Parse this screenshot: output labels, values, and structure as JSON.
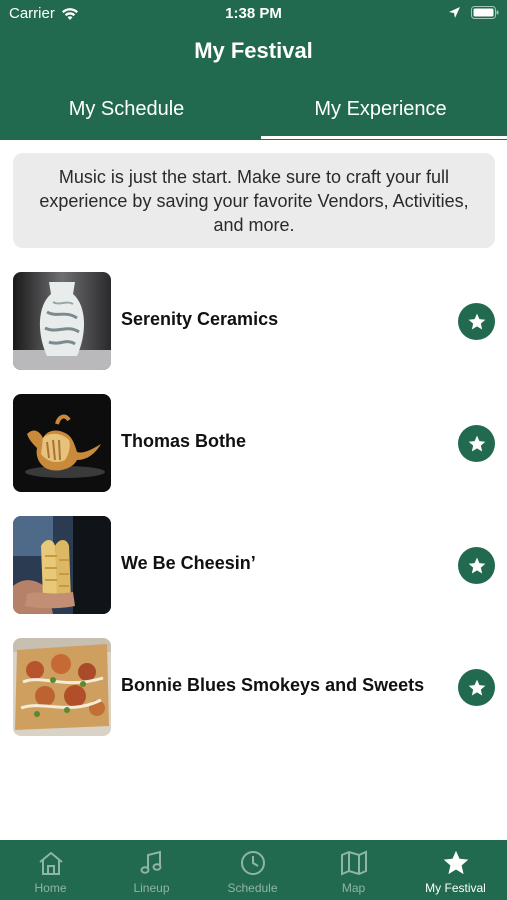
{
  "status_bar": {
    "carrier": "Carrier",
    "time": "1:38 PM",
    "icons": [
      "wifi-icon",
      "location-arrow-icon",
      "battery-icon"
    ]
  },
  "header": {
    "title": "My Festival",
    "tabs": [
      {
        "label": "My Schedule",
        "active": false
      },
      {
        "label": "My Experience",
        "active": true
      }
    ]
  },
  "notice": {
    "text": "Music is just the start. Make sure to craft your full experience by saving your favorite Vendors, Activities, and more."
  },
  "vendors": [
    {
      "name": "Serenity Ceramics",
      "image": "ceramic-vase-photo",
      "favorited": true
    },
    {
      "name": "Thomas Bothe",
      "image": "ceramic-teapot-photo",
      "favorited": true
    },
    {
      "name": "We Be Cheesin’",
      "image": "cheese-bread-photo",
      "favorited": true
    },
    {
      "name": "Bonnie Blues Smokeys and Sweets",
      "image": "loaded-fries-photo",
      "favorited": true
    }
  ],
  "tabbar": {
    "items": [
      {
        "label": "Home",
        "icon": "home-icon",
        "active": false
      },
      {
        "label": "Lineup",
        "icon": "music-note-icon",
        "active": false
      },
      {
        "label": "Schedule",
        "icon": "clock-icon",
        "active": false
      },
      {
        "label": "Map",
        "icon": "map-icon",
        "active": false
      },
      {
        "label": "My Festival",
        "icon": "star-icon",
        "active": true
      }
    ]
  },
  "colors": {
    "brand_green": "#226a4f",
    "notice_bg": "#ebebeb",
    "inactive_tab": "#8fb5a6",
    "active_tab": "#ffffff"
  }
}
